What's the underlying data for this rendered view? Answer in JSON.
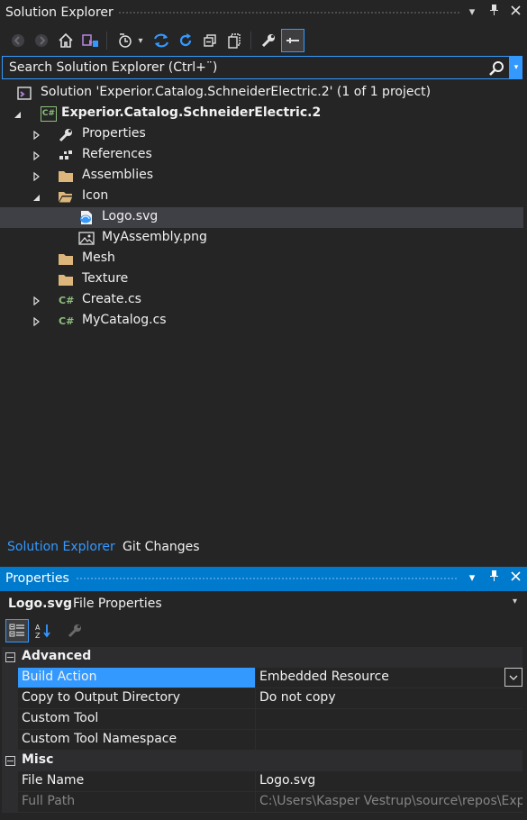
{
  "solution_explorer": {
    "title": "Solution Explorer",
    "search_placeholder": "Search Solution Explorer (Ctrl+¨)",
    "solution_label": "Solution 'Experior.Catalog.SchneiderElectric.2' (1 of 1 project)",
    "project_label": "Experior.Catalog.SchneiderElectric.2",
    "project_icon_text": "C#",
    "items": [
      {
        "label": "Properties",
        "icon": "wrench-icon"
      },
      {
        "label": "References",
        "icon": "references-icon"
      },
      {
        "label": "Assemblies",
        "icon": "folder-icon"
      },
      {
        "label": "Icon",
        "icon": "folder-open-icon"
      },
      {
        "label": "Logo.svg",
        "icon": "svg-file-icon",
        "selected": true
      },
      {
        "label": "MyAssembly.png",
        "icon": "image-file-icon"
      },
      {
        "label": "Mesh",
        "icon": "folder-icon"
      },
      {
        "label": "Texture",
        "icon": "folder-icon"
      },
      {
        "label": "Create.cs",
        "icon": "csharp-file-icon"
      },
      {
        "label": "MyCatalog.cs",
        "icon": "csharp-file-icon"
      }
    ],
    "csharp_badge": "C#",
    "tabs": [
      "Solution Explorer",
      "Git Changes"
    ]
  },
  "properties": {
    "title": "Properties",
    "object_name": "Logo.svg",
    "object_type": "File Properties",
    "categories": [
      {
        "name": "Advanced",
        "rows": [
          {
            "name": "Build Action",
            "value": "Embedded Resource"
          },
          {
            "name": "Copy to Output Directory",
            "value": "Do not copy"
          },
          {
            "name": "Custom Tool",
            "value": ""
          },
          {
            "name": "Custom Tool Namespace",
            "value": ""
          }
        ]
      },
      {
        "name": "Misc",
        "rows": [
          {
            "name": "File Name",
            "value": "Logo.svg"
          },
          {
            "name": "Full Path",
            "value": "C:\\Users\\Kasper Vestrup\\source\\repos\\Exper"
          }
        ]
      }
    ]
  },
  "colors": {
    "background": "#252526",
    "accent": "#007acc",
    "selection": "#3399ff",
    "folder": "#dcb67a",
    "csharp": "#8ec07c"
  }
}
